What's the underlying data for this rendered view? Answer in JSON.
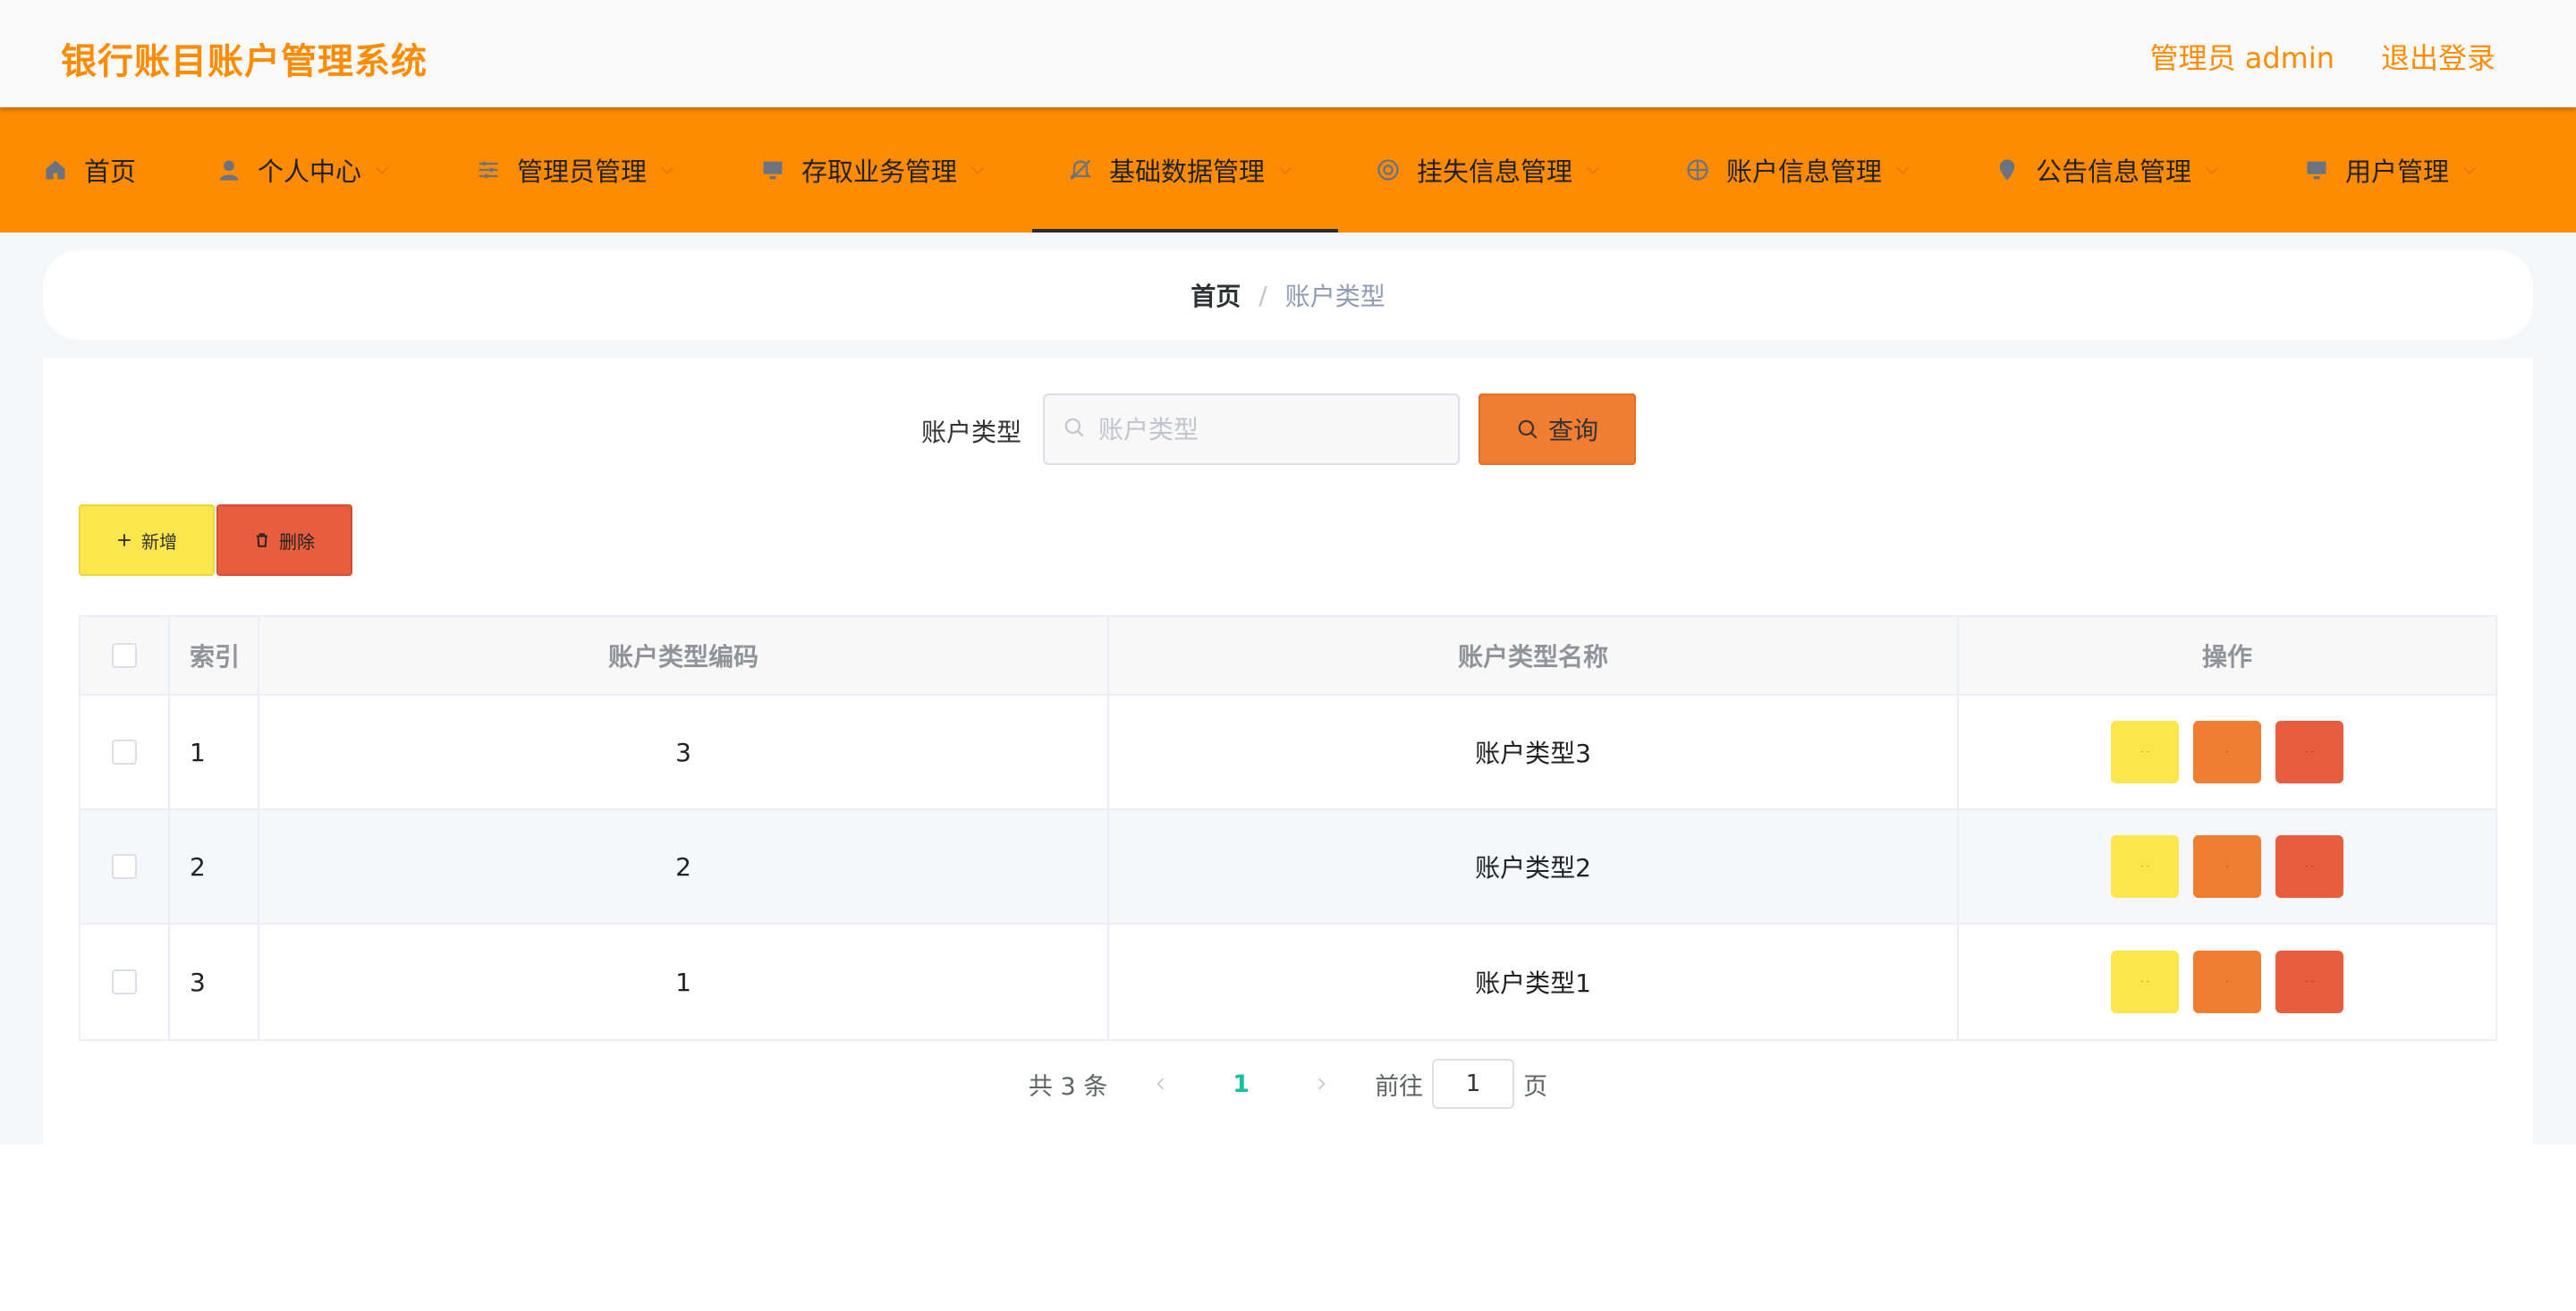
{
  "app": {
    "title": "银行账目账户管理系统"
  },
  "header": {
    "admin_label": "管理员 admin",
    "logout_label": "退出登录"
  },
  "nav": {
    "items": [
      {
        "label": "首页",
        "icon": "home-icon",
        "has_menu": false
      },
      {
        "label": "个人中心",
        "icon": "user-icon",
        "has_menu": true
      },
      {
        "label": "管理员管理",
        "icon": "sliders-icon",
        "has_menu": true
      },
      {
        "label": "存取业务管理",
        "icon": "monitor-icon",
        "has_menu": true
      },
      {
        "label": "基础数据管理",
        "icon": "bell-off-icon",
        "has_menu": true,
        "active": true
      },
      {
        "label": "挂失信息管理",
        "icon": "lifebuoy-icon",
        "has_menu": true
      },
      {
        "label": "账户信息管理",
        "icon": "crosshair-icon",
        "has_menu": true
      },
      {
        "label": "公告信息管理",
        "icon": "map-pin-icon",
        "has_menu": true
      },
      {
        "label": "用户管理",
        "icon": "monitor-icon",
        "has_menu": true
      }
    ]
  },
  "breadcrumb": {
    "home": "首页",
    "separator": "/",
    "current": "账户类型"
  },
  "search": {
    "label": "账户类型",
    "placeholder": "账户类型",
    "value": "",
    "button_label": "查询"
  },
  "actions": {
    "add_label": "新增",
    "delete_label": "删除"
  },
  "table": {
    "columns": [
      "索引",
      "账户类型编码",
      "账户类型名称",
      "操作"
    ],
    "rows": [
      {
        "index": "1",
        "code": "3",
        "name": "账户类型3"
      },
      {
        "index": "2",
        "code": "2",
        "name": "账户类型2"
      },
      {
        "index": "3",
        "code": "1",
        "name": "账户类型1"
      }
    ]
  },
  "pagination": {
    "total_text": "共 3 条",
    "current_page": "1",
    "goto_label": "前往",
    "page_input": "1",
    "page_suffix": "页"
  },
  "colors": {
    "brand": "#ff8c00",
    "add": "#fbe74c",
    "query": "#f07d32",
    "delete": "#e85d3d",
    "page_active": "#13c2a0"
  }
}
